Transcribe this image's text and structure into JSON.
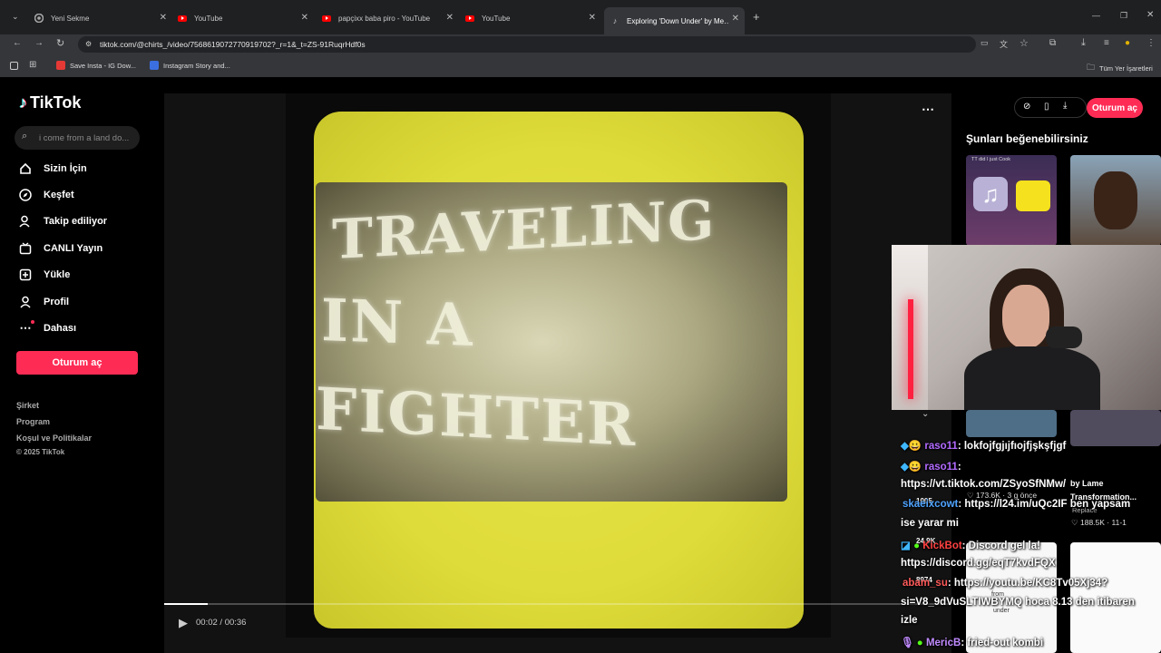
{
  "browser": {
    "tabs": [
      {
        "title": "Yeni Sekme",
        "icon": "chrome-icon"
      },
      {
        "title": "YouTube",
        "icon": "youtube-icon"
      },
      {
        "title": "papçixx baba piro - YouTube",
        "icon": "youtube-icon"
      },
      {
        "title": "YouTube",
        "icon": "youtube-icon"
      },
      {
        "title": "Exploring 'Down Under' by Me…",
        "icon": "tiktok-icon"
      }
    ],
    "url": "tiktok.com/@chirts_/video/7568619072770919702?_r=1&_t=ZS-91RuqrHdf0s",
    "bookmarks": [
      {
        "label": "Save Insta - IG Dow..."
      },
      {
        "label": "Instagram Story and..."
      }
    ],
    "all_bookmarks": "Tüm Yer İşaretleri"
  },
  "tiktok": {
    "logo": "TikTok",
    "search_placeholder": "i come from a land do...",
    "nav": [
      {
        "label": "Sizin İçin",
        "icon": "home-icon"
      },
      {
        "label": "Keşfet",
        "icon": "compass-icon"
      },
      {
        "label": "Takip ediliyor",
        "icon": "following-icon"
      },
      {
        "label": "CANLI Yayın",
        "icon": "live-icon"
      },
      {
        "label": "Yükle",
        "icon": "upload-icon"
      },
      {
        "label": "Profil",
        "icon": "profile-icon"
      },
      {
        "label": "Dahası",
        "icon": "more-icon"
      }
    ],
    "login_button": "Oturum aç",
    "footer": {
      "company": "Şirket",
      "program": "Program",
      "terms": "Koşul ve Politikalar",
      "copyright": "© 2025 TikTok"
    },
    "video": {
      "title_lines": [
        "TRAVELING",
        "IN A",
        "FIGHTER"
      ],
      "time": "00:02 / 00:36",
      "progress": 0.055
    },
    "top_login": "Oturum aç",
    "suggestions_title": "Şunları beğenebilirsiniz",
    "suggestions": [
      {
        "views": "173.6K",
        "when": "3 g önce"
      },
      {
        "title": "by Lame Transformation...",
        "subtitle": "Replace",
        "views": "188.5K",
        "when": "11-1"
      }
    ],
    "thumb_text": [
      "TT did I just Cook",
      "from",
      "under"
    ]
  },
  "chat": [
    {
      "user": "raso11",
      "user_color": "#b26bff",
      "text": ": lokfojfgjıjfıojfjşkşfjgf"
    },
    {
      "user": "raso11",
      "user_color": "#b26bff",
      "text": ":"
    },
    {
      "user": "",
      "user_color": "#ffffff",
      "text": "https://vt.tiktok.com/ZSyoSfNMw/"
    },
    {
      "user": "skaeixcowt",
      "user_color": "#4fa3ff",
      "text": ": https://l24.im/uQc2IF ben yapsam"
    },
    {
      "user": "",
      "user_color": "#ffffff",
      "text": "ise yarar mi"
    },
    {
      "user": "KickBot",
      "user_color": "#ff4040",
      "text": ": Discord gel la!"
    },
    {
      "user": "",
      "user_color": "#ffffff",
      "text": "https://discord.gg/eqT7kvdFQX"
    },
    {
      "user": "abam_su",
      "user_color": "#ff5a5a",
      "text": ": https://youtu.be/KC8Tv05Xj34?"
    },
    {
      "user": "",
      "user_color": "#ffffff",
      "text": "si=V8_9dVuSLTIWBYMQ hoca 8.13 den itibaren"
    },
    {
      "user": "",
      "user_color": "#ffffff",
      "text": "izle"
    },
    {
      "user": "MericB",
      "user_color": "#c08bff",
      "text": ": fried-out kombi"
    }
  ],
  "overlay_numbers": [
    "1005",
    "24.9K",
    "8974"
  ]
}
